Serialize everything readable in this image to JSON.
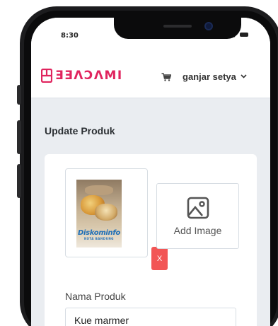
{
  "status_bar": {
    "time": "8:30"
  },
  "app": {
    "logo_text": "ƎƎΛƆΛMI",
    "brand_color": "#e0245e",
    "user_name": "ganjar setya",
    "cart_icon": "cart-icon",
    "menu_icon": "chevron-down-icon"
  },
  "page": {
    "title": "Update Produk"
  },
  "image_upload": {
    "photo_watermark": "Diskominfo",
    "photo_watermark_sub": "KOTA BANDUNG",
    "remove_label": "X",
    "remove_color": "#f25555",
    "add_label": "Add Image",
    "add_icon": "image-icon"
  },
  "form": {
    "name_label": "Nama Produk",
    "name_value": "Kue marmer"
  }
}
